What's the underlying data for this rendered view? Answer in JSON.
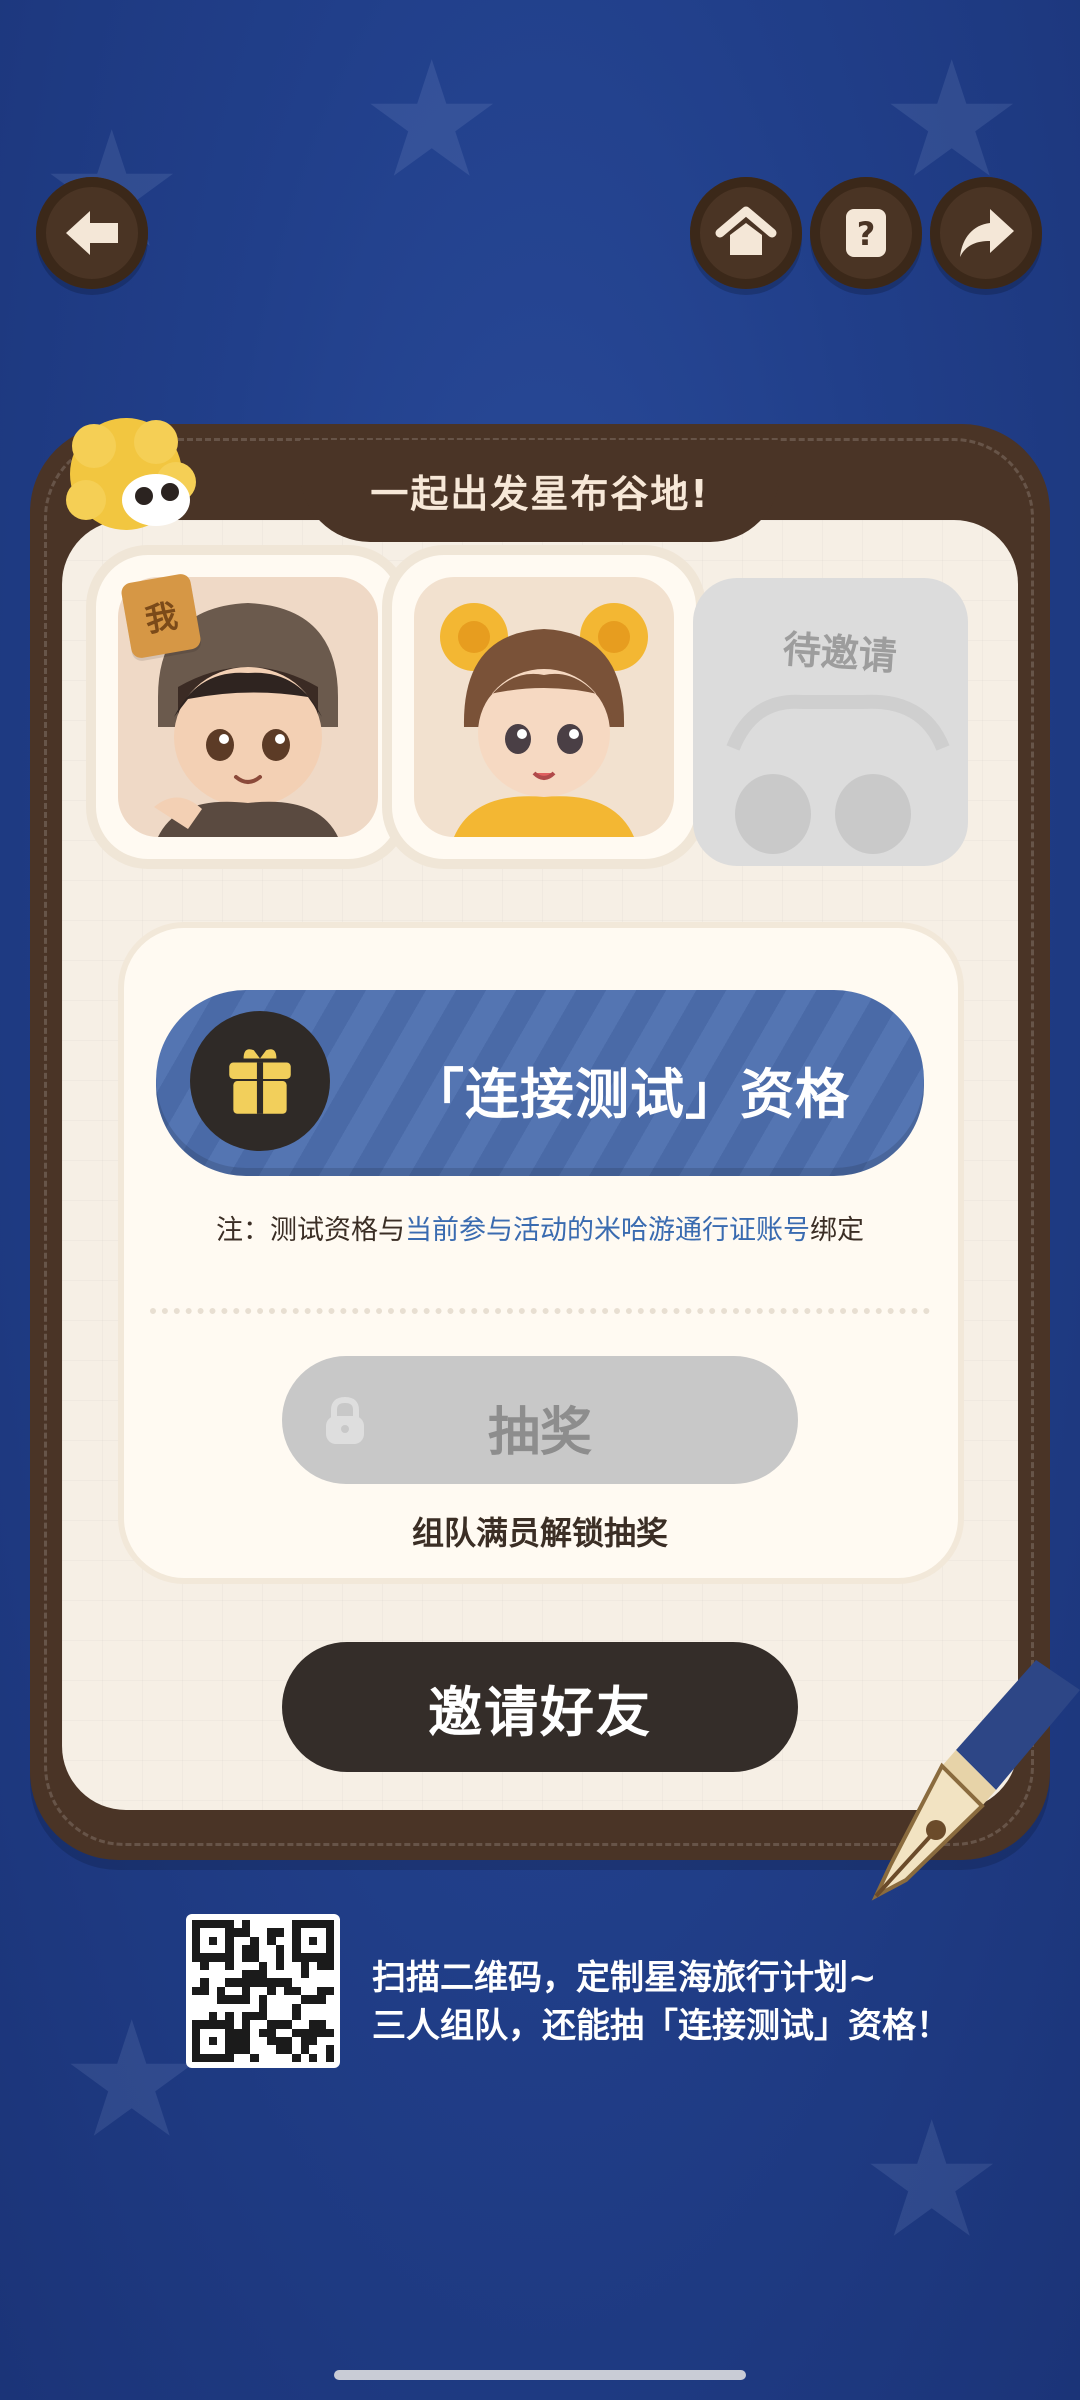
{
  "header": {
    "back_icon": "back-arrow-icon",
    "home_icon": "home-icon",
    "help_icon": "question-icon",
    "share_icon": "share-arrow-icon"
  },
  "card": {
    "title": "一起出发星布谷地!",
    "me_tag": "我",
    "invite_slot_label": "待邀请",
    "reward_label": "「连接测试」资格",
    "note_prefix": "注：测试资格与",
    "note_highlight": "当前参与活动的米哈游通行证账号",
    "note_suffix": "绑定",
    "lottery_label": "抽奖",
    "unlock_hint": "组队满员解锁抽奖",
    "invite_button": "邀请好友"
  },
  "footer": {
    "qr_line1": "扫描二维码，定制星海旅行计划~",
    "qr_line2": "三人组队，还能抽「连接测试」资格！"
  },
  "colors": {
    "background": "#213f8a",
    "card_brown": "#4a3426",
    "card_cream": "#f6efe5",
    "banner_blue": "#4a6aa7",
    "highlight_blue": "#3a6bb0",
    "dark_button": "#342d29",
    "disabled_gray": "#c8c8c8"
  }
}
